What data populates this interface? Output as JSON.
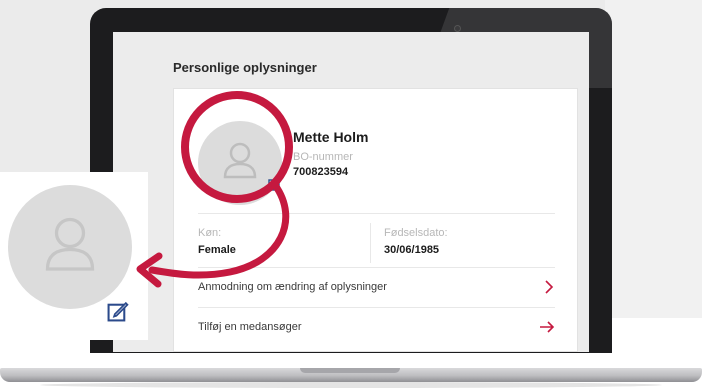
{
  "screen": {
    "section_title": "Personlige oplysninger",
    "profile": {
      "name": "Mette Holm",
      "id_label": "BO-nummer",
      "id_value": "700823594"
    },
    "fields": [
      {
        "label": "Køn:",
        "value": "Female"
      },
      {
        "label": "Fødselsdato:",
        "value": "30/06/1985"
      }
    ],
    "actions": [
      {
        "label": "Anmodning om ændring af oplysninger",
        "icon": "chevron-right-icon"
      },
      {
        "label": "Tilføj en medansøger",
        "icon": "arrow-right-icon"
      }
    ]
  },
  "colors": {
    "accent": "#c5193f",
    "avatar_bg": "#dcdcdc",
    "edit_icon": "#2b4a8b"
  }
}
